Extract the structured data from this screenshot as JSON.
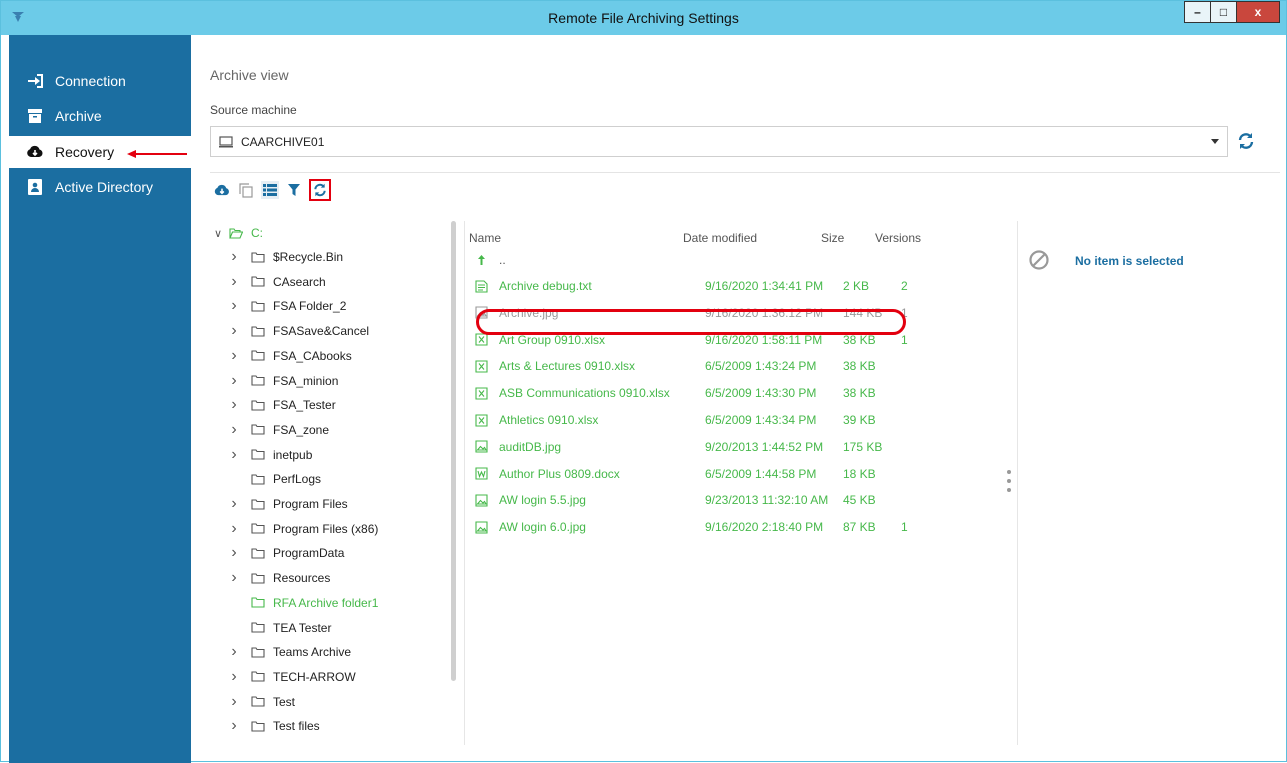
{
  "window": {
    "title": "Remote File Archiving Settings",
    "minimize": "–",
    "maximize": "□",
    "close": "x"
  },
  "sidebar": {
    "items": [
      {
        "label": "Connection",
        "icon": "sign-in-icon"
      },
      {
        "label": "Archive",
        "icon": "archive-box-icon"
      },
      {
        "label": "Recovery",
        "icon": "cloud-download-icon",
        "active": true
      },
      {
        "label": "Active Directory",
        "icon": "address-book-icon"
      }
    ]
  },
  "main": {
    "section_title": "Archive view",
    "source_label": "Source machine",
    "source_value": "CAARCHIVE01"
  },
  "toolbar": [
    "cloud-download-icon",
    "copy-icon",
    "list-view-icon",
    "filter-icon",
    "refresh-icon"
  ],
  "tree": {
    "root": "C:",
    "items": [
      {
        "label": "$Recycle.Bin",
        "expandable": true
      },
      {
        "label": "CAsearch",
        "expandable": true
      },
      {
        "label": "FSA Folder_2",
        "expandable": true
      },
      {
        "label": "FSASave&Cancel",
        "expandable": true
      },
      {
        "label": "FSA_CAbooks",
        "expandable": true
      },
      {
        "label": "FSA_minion",
        "expandable": true
      },
      {
        "label": "FSA_Tester",
        "expandable": true
      },
      {
        "label": "FSA_zone",
        "expandable": true
      },
      {
        "label": "inetpub",
        "expandable": true
      },
      {
        "label": "PerfLogs",
        "expandable": false
      },
      {
        "label": "Program Files",
        "expandable": true
      },
      {
        "label": "Program Files (x86)",
        "expandable": true
      },
      {
        "label": "ProgramData",
        "expandable": true
      },
      {
        "label": "Resources",
        "expandable": true
      },
      {
        "label": "RFA Archive folder1",
        "expandable": false,
        "archived": true
      },
      {
        "label": "TEA Tester",
        "expandable": false
      },
      {
        "label": "Teams Archive",
        "expandable": true
      },
      {
        "label": "TECH-ARROW",
        "expandable": true
      },
      {
        "label": "Test",
        "expandable": true
      },
      {
        "label": "Test files",
        "expandable": true
      }
    ]
  },
  "files": {
    "columns": [
      "Name",
      "Date modified",
      "Size",
      "Versions"
    ],
    "up": "..",
    "rows": [
      {
        "name": "Archive debug.txt",
        "date": "9/16/2020 1:34:41 PM",
        "size": "2 KB",
        "versions": "2",
        "type": "text"
      },
      {
        "name": "Archive.jpg",
        "date": "9/16/2020 1:36:12 PM",
        "size": "144 KB",
        "versions": "1",
        "type": "image",
        "greyed": true
      },
      {
        "name": "Art Group 0910.xlsx",
        "date": "9/16/2020 1:58:11 PM",
        "size": "38 KB",
        "versions": "1",
        "type": "excel"
      },
      {
        "name": "Arts & Lectures 0910.xlsx",
        "date": "6/5/2009 1:43:24 PM",
        "size": "38 KB",
        "versions": "",
        "type": "excel"
      },
      {
        "name": "ASB Communications 0910.xlsx",
        "date": "6/5/2009 1:43:30 PM",
        "size": "38 KB",
        "versions": "",
        "type": "excel"
      },
      {
        "name": "Athletics 0910.xlsx",
        "date": "6/5/2009 1:43:34 PM",
        "size": "39 KB",
        "versions": "",
        "type": "excel"
      },
      {
        "name": "auditDB.jpg",
        "date": "9/20/2013 1:44:52 PM",
        "size": "175 KB",
        "versions": "",
        "type": "image"
      },
      {
        "name": "Author Plus 0809.docx",
        "date": "6/5/2009 1:44:58 PM",
        "size": "18 KB",
        "versions": "",
        "type": "word"
      },
      {
        "name": "AW login 5.5.jpg",
        "date": "9/23/2013 11:32:10 AM",
        "size": "45 KB",
        "versions": "",
        "type": "image"
      },
      {
        "name": "AW login 6.0.jpg",
        "date": "9/16/2020 2:18:40 PM",
        "size": "87 KB",
        "versions": "1",
        "type": "image"
      }
    ]
  },
  "details": {
    "empty_text": "No item is selected"
  },
  "colors": {
    "sidebar": "#1b6ea1",
    "titlebar": "#6ccbe8",
    "archived_green": "#46b84a",
    "highlight_red": "#e3000f"
  }
}
